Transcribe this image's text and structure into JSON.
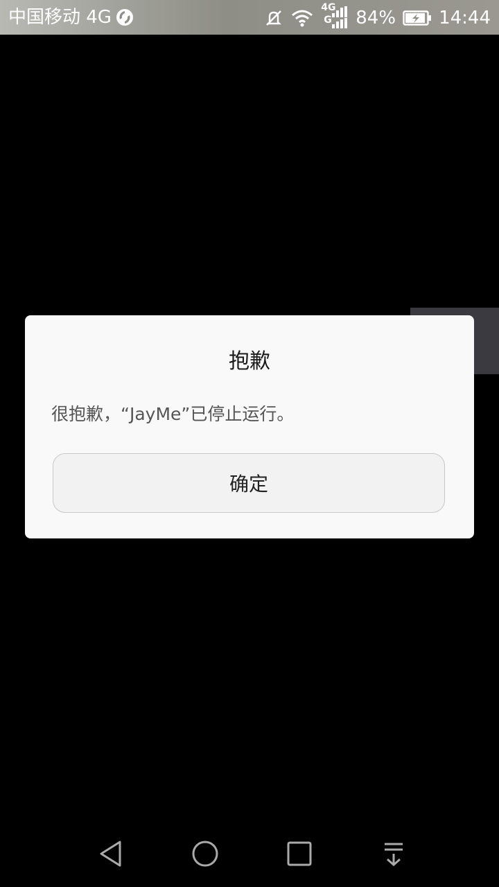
{
  "status_bar": {
    "carrier": "中国移动 4G",
    "network_type": "4G",
    "network_type_secondary": "G",
    "battery": "84%",
    "time": "14:44",
    "icons": [
      "sync-icon",
      "mute-icon",
      "wifi-icon",
      "signal-icon",
      "battery-charging-icon"
    ]
  },
  "dialog": {
    "title": "抱歉",
    "message": "很抱歉，“JayMe”已停止运行。",
    "ok_label": "确定"
  },
  "nav_bar": {
    "icons": [
      "back-icon",
      "home-icon",
      "recents-icon",
      "notification-pull-icon"
    ]
  },
  "colors": {
    "dialog_bg": "#f9f9f9",
    "screen_bg": "#000000",
    "side_tab": "#3a3a40"
  }
}
